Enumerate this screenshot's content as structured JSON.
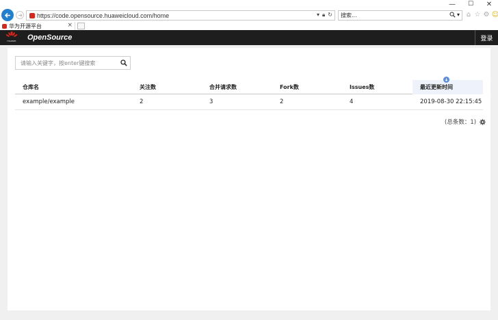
{
  "browser": {
    "window_controls": {
      "minimize": "—",
      "maximize": "☐",
      "close": "✕"
    },
    "url": "https://code.opensource.huaweicloud.com/home",
    "search_placeholder": "搜索...",
    "tab_title": "华为开源平台",
    "icons": [
      "back-arrow-icon",
      "forward-arrow-icon",
      "lock-icon",
      "refresh-icon",
      "search-icon",
      "home-icon",
      "star-icon",
      "gear-icon",
      "smiley-icon"
    ]
  },
  "header": {
    "logo_text": "HUAWEI",
    "brand": "OpenSource",
    "login_label": "登录"
  },
  "search": {
    "placeholder": "请输入关键字，按enter键搜索"
  },
  "table": {
    "columns": [
      "仓库名",
      "关注数",
      "合并请求数",
      "Fork数",
      "Issues数",
      "最近更新时间"
    ],
    "rows": [
      [
        "example/example",
        "2",
        "3",
        "2",
        "4",
        "2019-08-30 22:15:45"
      ]
    ],
    "sorted_column": "最近更新时间"
  },
  "footer": {
    "total_text": "(总条数：1)"
  },
  "colors": {
    "app_bar": "#1e1e1e",
    "brand_red": "#d8261c",
    "accent_blue": "#1f7fd0",
    "sort_badge": "#5b8ee0"
  }
}
